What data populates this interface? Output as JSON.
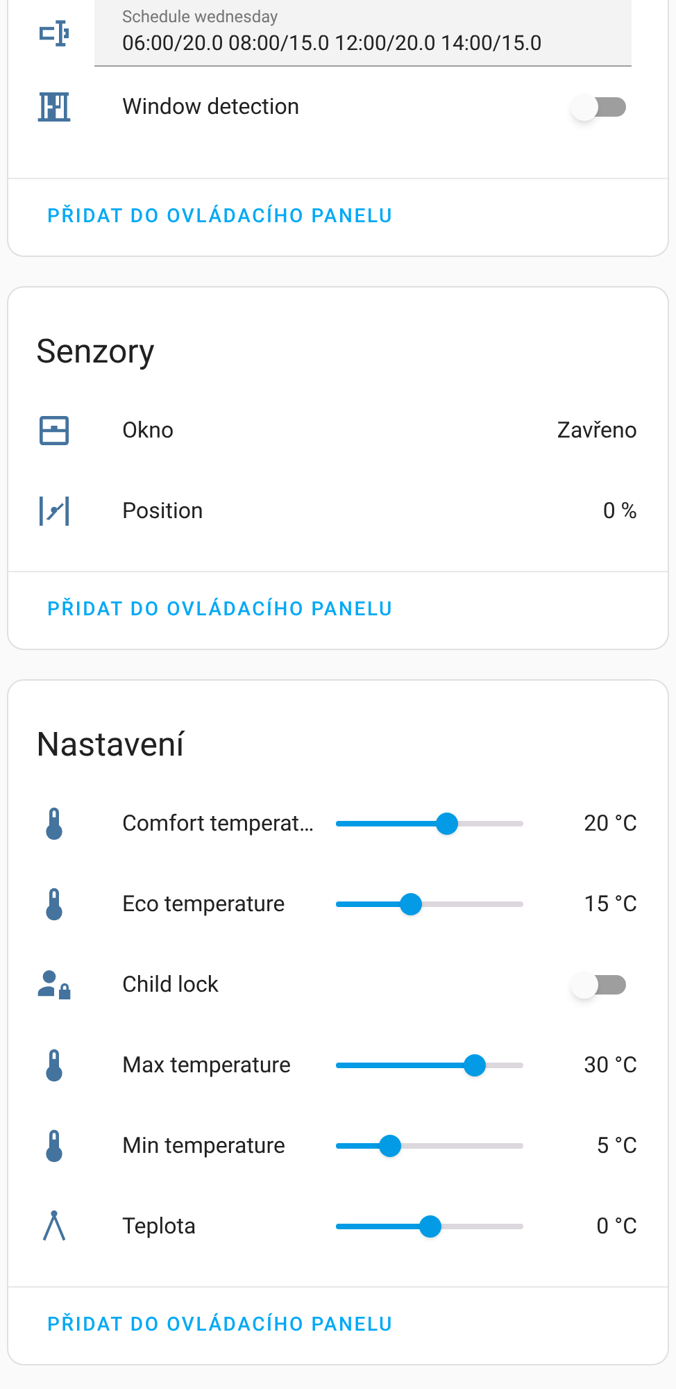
{
  "cards": [
    {
      "rows": [
        {
          "kind": "field",
          "label": "Schedule wednesday",
          "value": "06:00/20.0 08:00/15.0 12:00/20.0 14:00/15.0"
        },
        {
          "kind": "toggle",
          "label": "Window detection",
          "on": false
        }
      ],
      "action": "PŘIDAT DO OVLÁDACÍHO PANELU"
    },
    {
      "title": "Senzory",
      "rows": [
        {
          "kind": "sensor",
          "label": "Okno",
          "value": "Zavřeno"
        },
        {
          "kind": "sensor",
          "label": "Position",
          "value": "0 %"
        }
      ],
      "action": "PŘIDAT DO OVLÁDACÍHO PANELU"
    },
    {
      "title": "Nastavení",
      "rows": [
        {
          "kind": "slider",
          "label": "Comfort temperat…",
          "level": 0.59,
          "value": "20 °C"
        },
        {
          "kind": "slider",
          "label": "Eco temperature",
          "level": 0.4,
          "value": "15 °C"
        },
        {
          "kind": "toggle",
          "label": "Child lock",
          "on": false
        },
        {
          "kind": "slider",
          "label": "Max temperature",
          "level": 0.74,
          "value": "30 °C"
        },
        {
          "kind": "slider",
          "label": "Min temperature",
          "level": 0.29,
          "value": "5 °C"
        },
        {
          "kind": "slider",
          "label": "Teplota",
          "level": 0.5,
          "value": "0 °C"
        }
      ],
      "action": "PŘIDAT DO OVLÁDACÍHO PANELU"
    }
  ]
}
